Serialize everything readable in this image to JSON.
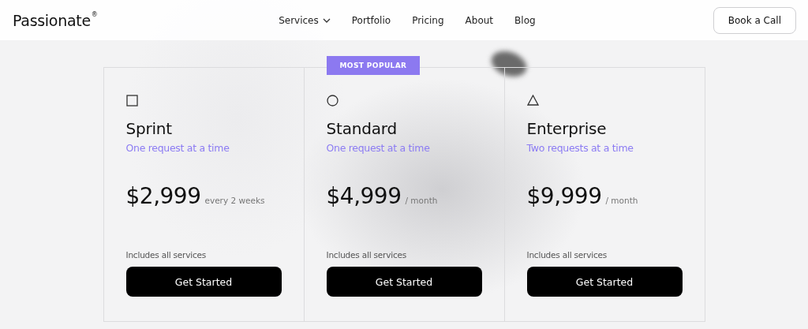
{
  "header": {
    "logo": "Passionate",
    "logo_mark": "®",
    "nav": [
      {
        "label": "Services",
        "dropdown": true
      },
      {
        "label": "Portfolio",
        "dropdown": false
      },
      {
        "label": "Pricing",
        "dropdown": false
      },
      {
        "label": "About",
        "dropdown": false
      },
      {
        "label": "Blog",
        "dropdown": false
      }
    ],
    "cta": "Book a Call"
  },
  "plans": [
    {
      "kind": "square",
      "name": "Sprint",
      "subtitle": "One request at a time",
      "price": "$2,999",
      "period": "every 2 weeks",
      "note": "Includes all services",
      "button": "Get Started"
    },
    {
      "kind": "circle",
      "name": "Standard",
      "subtitle": "One request at a time",
      "price": "$4,999",
      "period": "/ month",
      "note": "Includes all services",
      "button": "Get Started",
      "badge": "MOST POPULAR"
    },
    {
      "kind": "triangle",
      "name": "Enterprise",
      "subtitle": "Two requests at a time",
      "price": "$9,999",
      "period": "/ month",
      "note": "Includes all services",
      "button": "Get Started"
    }
  ]
}
